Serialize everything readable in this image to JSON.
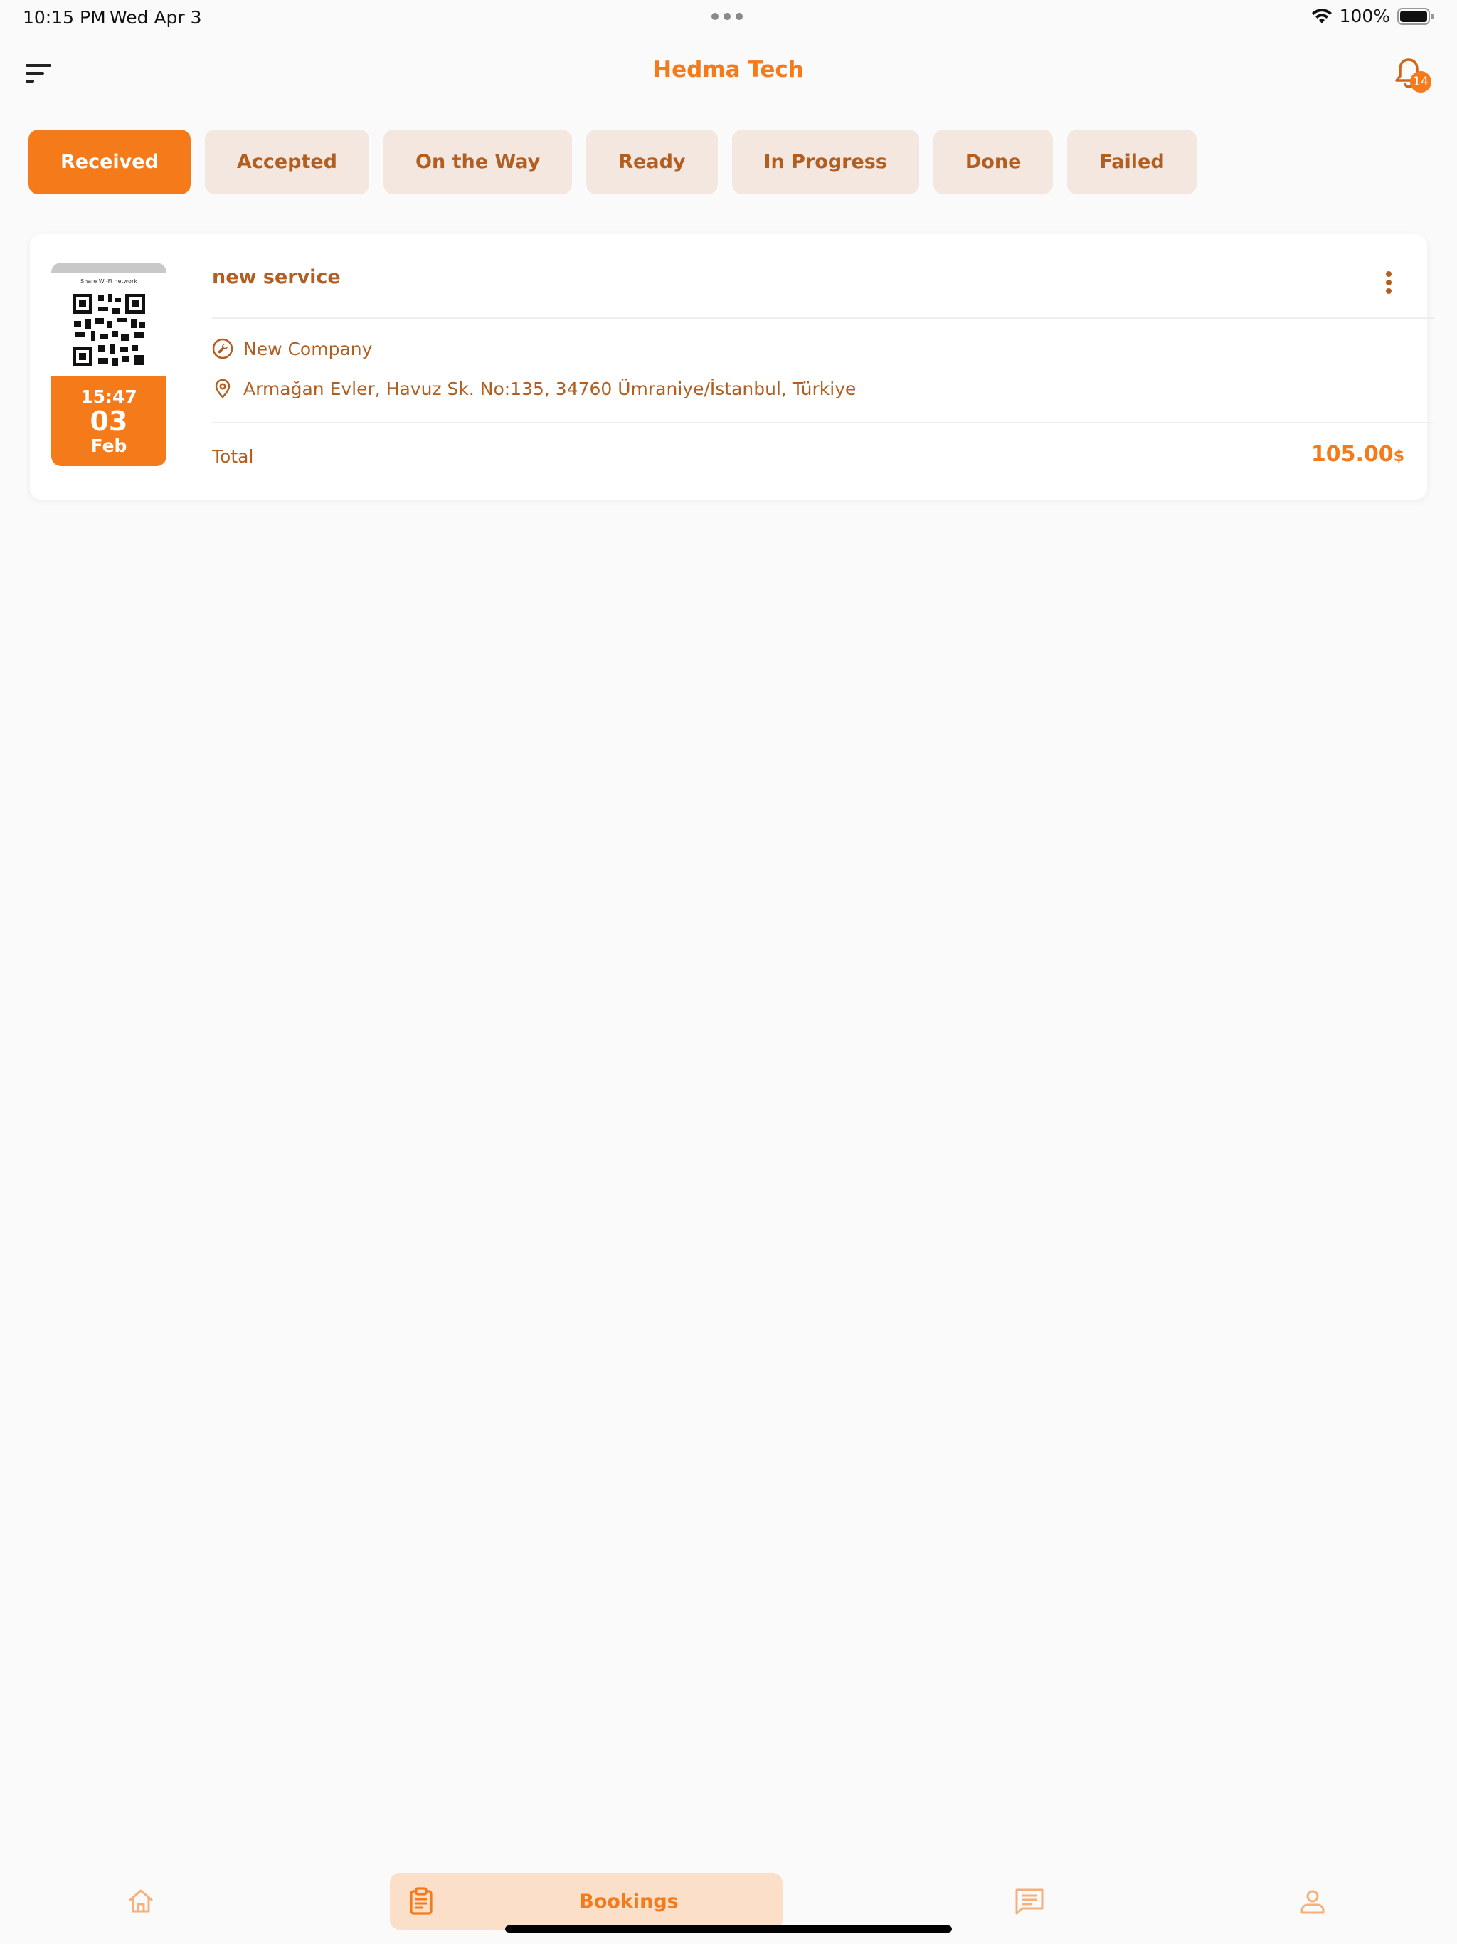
{
  "status_bar": {
    "time": "10:15 PM",
    "date": "Wed Apr 3",
    "battery": "100%"
  },
  "header": {
    "title": "Hedma Tech",
    "notification_count": "14"
  },
  "tabs": [
    {
      "label": "Received",
      "active": true
    },
    {
      "label": "Accepted",
      "active": false
    },
    {
      "label": "On the Way",
      "active": false
    },
    {
      "label": "Ready",
      "active": false
    },
    {
      "label": "In Progress",
      "active": false
    },
    {
      "label": "Done",
      "active": false
    },
    {
      "label": "Failed",
      "active": false
    }
  ],
  "booking": {
    "thumbnail_caption": "Share Wi-Fi network",
    "time": "15:47",
    "day": "03",
    "month": "Feb",
    "service_name": "new service",
    "company": "New Company",
    "address": "Armağan Evler, Havuz Sk. No:135, 34760 Ümraniye/İstanbul, Türkiye",
    "total_label": "Total",
    "total_value": "105.00",
    "currency": "$"
  },
  "bottom_nav": {
    "bookings_label": "Bookings"
  },
  "colors": {
    "accent": "#f47a1a",
    "accent_text": "#b25e20",
    "tab_bg": "#f4e7df",
    "nav_active_bg": "#fbdfc9"
  }
}
